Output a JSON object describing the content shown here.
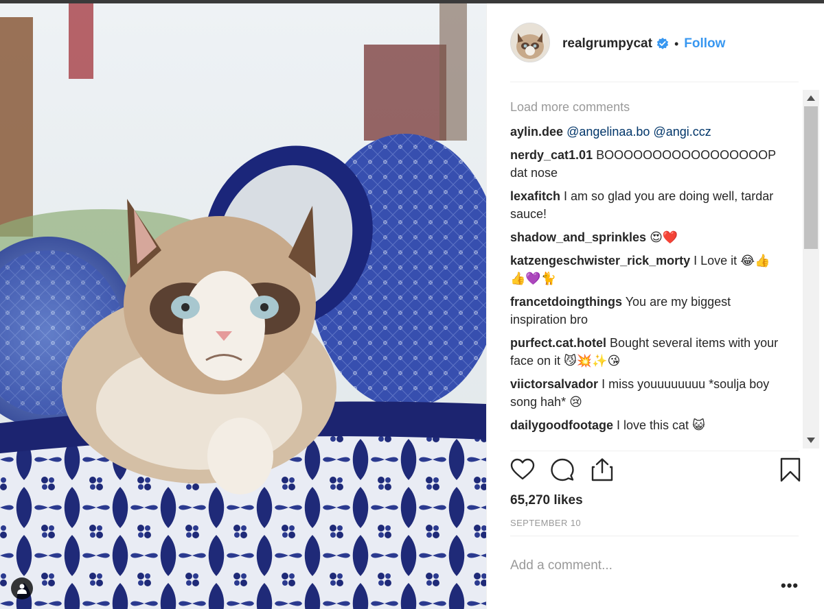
{
  "post": {
    "username": "realgrumpycat",
    "verified": true,
    "separator": "•",
    "follow_label": "Follow",
    "photo_alt": "Grumpy Cat in a blue and white ceramic pot"
  },
  "comments": {
    "load_more": "Load more comments",
    "items": [
      {
        "user": "aylin.dee",
        "text": "",
        "mentions": "@angelinaa.bo @angi.ccz"
      },
      {
        "user": "nerdy_cat1.01",
        "text": "BOOOOOOOOOOOOOOOOOP dat nose"
      },
      {
        "user": "lexafitch",
        "text": "I am so glad you are doing well, tardar sauce!"
      },
      {
        "user": "shadow_and_sprinkles",
        "text": "😍❤️"
      },
      {
        "user": "katzengeschwister_rick_morty",
        "text": "I Love it 😂👍👍💜🐈"
      },
      {
        "user": "francetdoingthings",
        "text": "You are my biggest inspiration bro"
      },
      {
        "user": "purfect.cat.hotel",
        "text": "Bought several items with your face on it 😼💥✨😘"
      },
      {
        "user": "viictorsalvador",
        "text": "I miss youuuuuuuu *soulja boy song hah* 😢"
      },
      {
        "user": "dailygoodfootage",
        "text": "I love this cat 😺"
      }
    ]
  },
  "actions": {
    "like_icon": "heart-icon",
    "comment_icon": "comment-icon",
    "share_icon": "share-icon",
    "save_icon": "bookmark-icon"
  },
  "likes": "65,270 likes",
  "date": "SEPTEMBER 10",
  "add_comment": {
    "placeholder": "Add a comment..."
  },
  "more_label": "•••",
  "colors": {
    "link_blue": "#3897f0",
    "mention_blue": "#003569",
    "muted": "#999999",
    "text": "#262626"
  }
}
